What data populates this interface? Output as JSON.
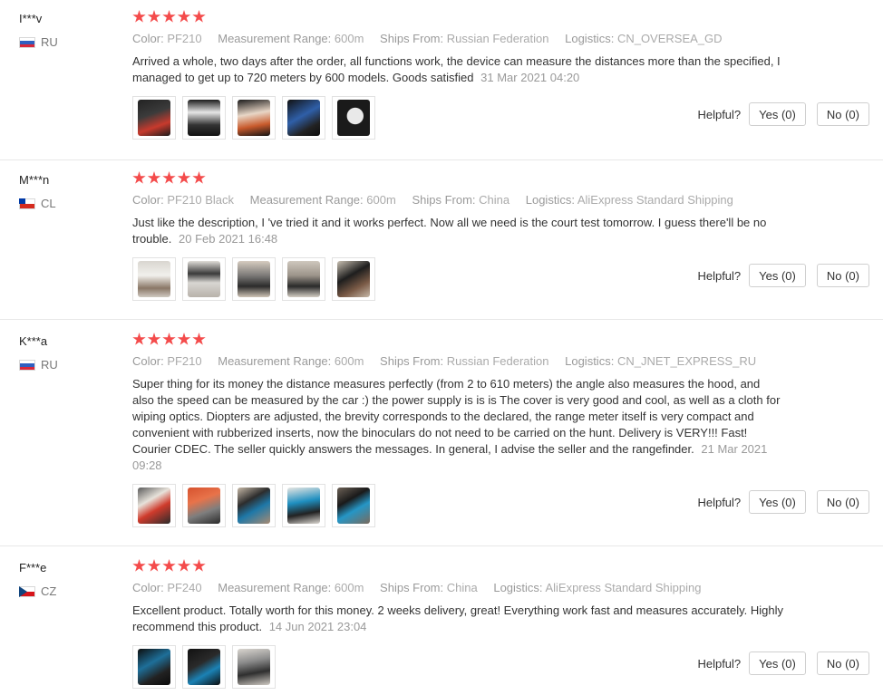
{
  "labels": {
    "color": "Color:",
    "measurement_range": "Measurement Range:",
    "ships_from": "Ships From:",
    "logistics": "Logistics:",
    "helpful": "Helpful?"
  },
  "colors": {
    "star": "#f44b4b",
    "meta_gray": "#999999",
    "text": "#333333"
  },
  "reviews": [
    {
      "user": "I***v",
      "country": "RU",
      "rating": 5,
      "color": "PF210",
      "measurement_range": "600m",
      "ships_from": "Russian Federation",
      "logistics": "CN_OVERSEA_GD",
      "text": "Arrived a whole, two days after the order, all functions work, the device can measure the distances more than the specified, I managed to get up to 720 meters by 600 models. Goods satisfied",
      "date": "31 Mar 2021 04:20",
      "photo_count": 5,
      "yes": "Yes (0)",
      "no": "No (0)"
    },
    {
      "user": "M***n",
      "country": "CL",
      "rating": 5,
      "color": "PF210 Black",
      "measurement_range": "600m",
      "ships_from": "China",
      "logistics": "AliExpress Standard Shipping",
      "text": "Just like the description, I 've tried it and it works perfect. Now all we need is the court test tomorrow. I guess there'll be no trouble.",
      "date": "20 Feb 2021 16:48",
      "photo_count": 5,
      "yes": "Yes (0)",
      "no": "No (0)"
    },
    {
      "user": "K***a",
      "country": "RU",
      "rating": 5,
      "color": "PF210",
      "measurement_range": "600m",
      "ships_from": "Russian Federation",
      "logistics": "CN_JNET_EXPRESS_RU",
      "text": "Super thing for its money the distance measures perfectly (from 2 to 610 meters) the angle also measures the hood, and also the speed can be measured by the car :) the power supply is is is The cover is very good and cool, as well as a cloth for wiping optics. Diopters are adjusted, the brevity corresponds to the declared, the range meter itself is very compact and convenient with rubberized inserts, now the binoculars do not need to be carried on the hunt. Delivery is VERY!!! Fast! Courier CDEC. The seller quickly answers the messages. In general, I advise the seller and the rangefinder.",
      "date": "21 Mar 2021 09:28",
      "photo_count": 5,
      "yes": "Yes (0)",
      "no": "No (0)"
    },
    {
      "user": "F***e",
      "country": "CZ",
      "rating": 5,
      "color": "PF240",
      "measurement_range": "600m",
      "ships_from": "China",
      "logistics": "AliExpress Standard Shipping",
      "text": "Excellent product. Totally worth for this money. 2 weeks delivery, great! Everything work fast and measures accurately. Highly recommend this product.",
      "date": "14 Jun 2021 23:04",
      "photo_count": 3,
      "yes": "Yes (0)",
      "no": "No (0)"
    }
  ]
}
